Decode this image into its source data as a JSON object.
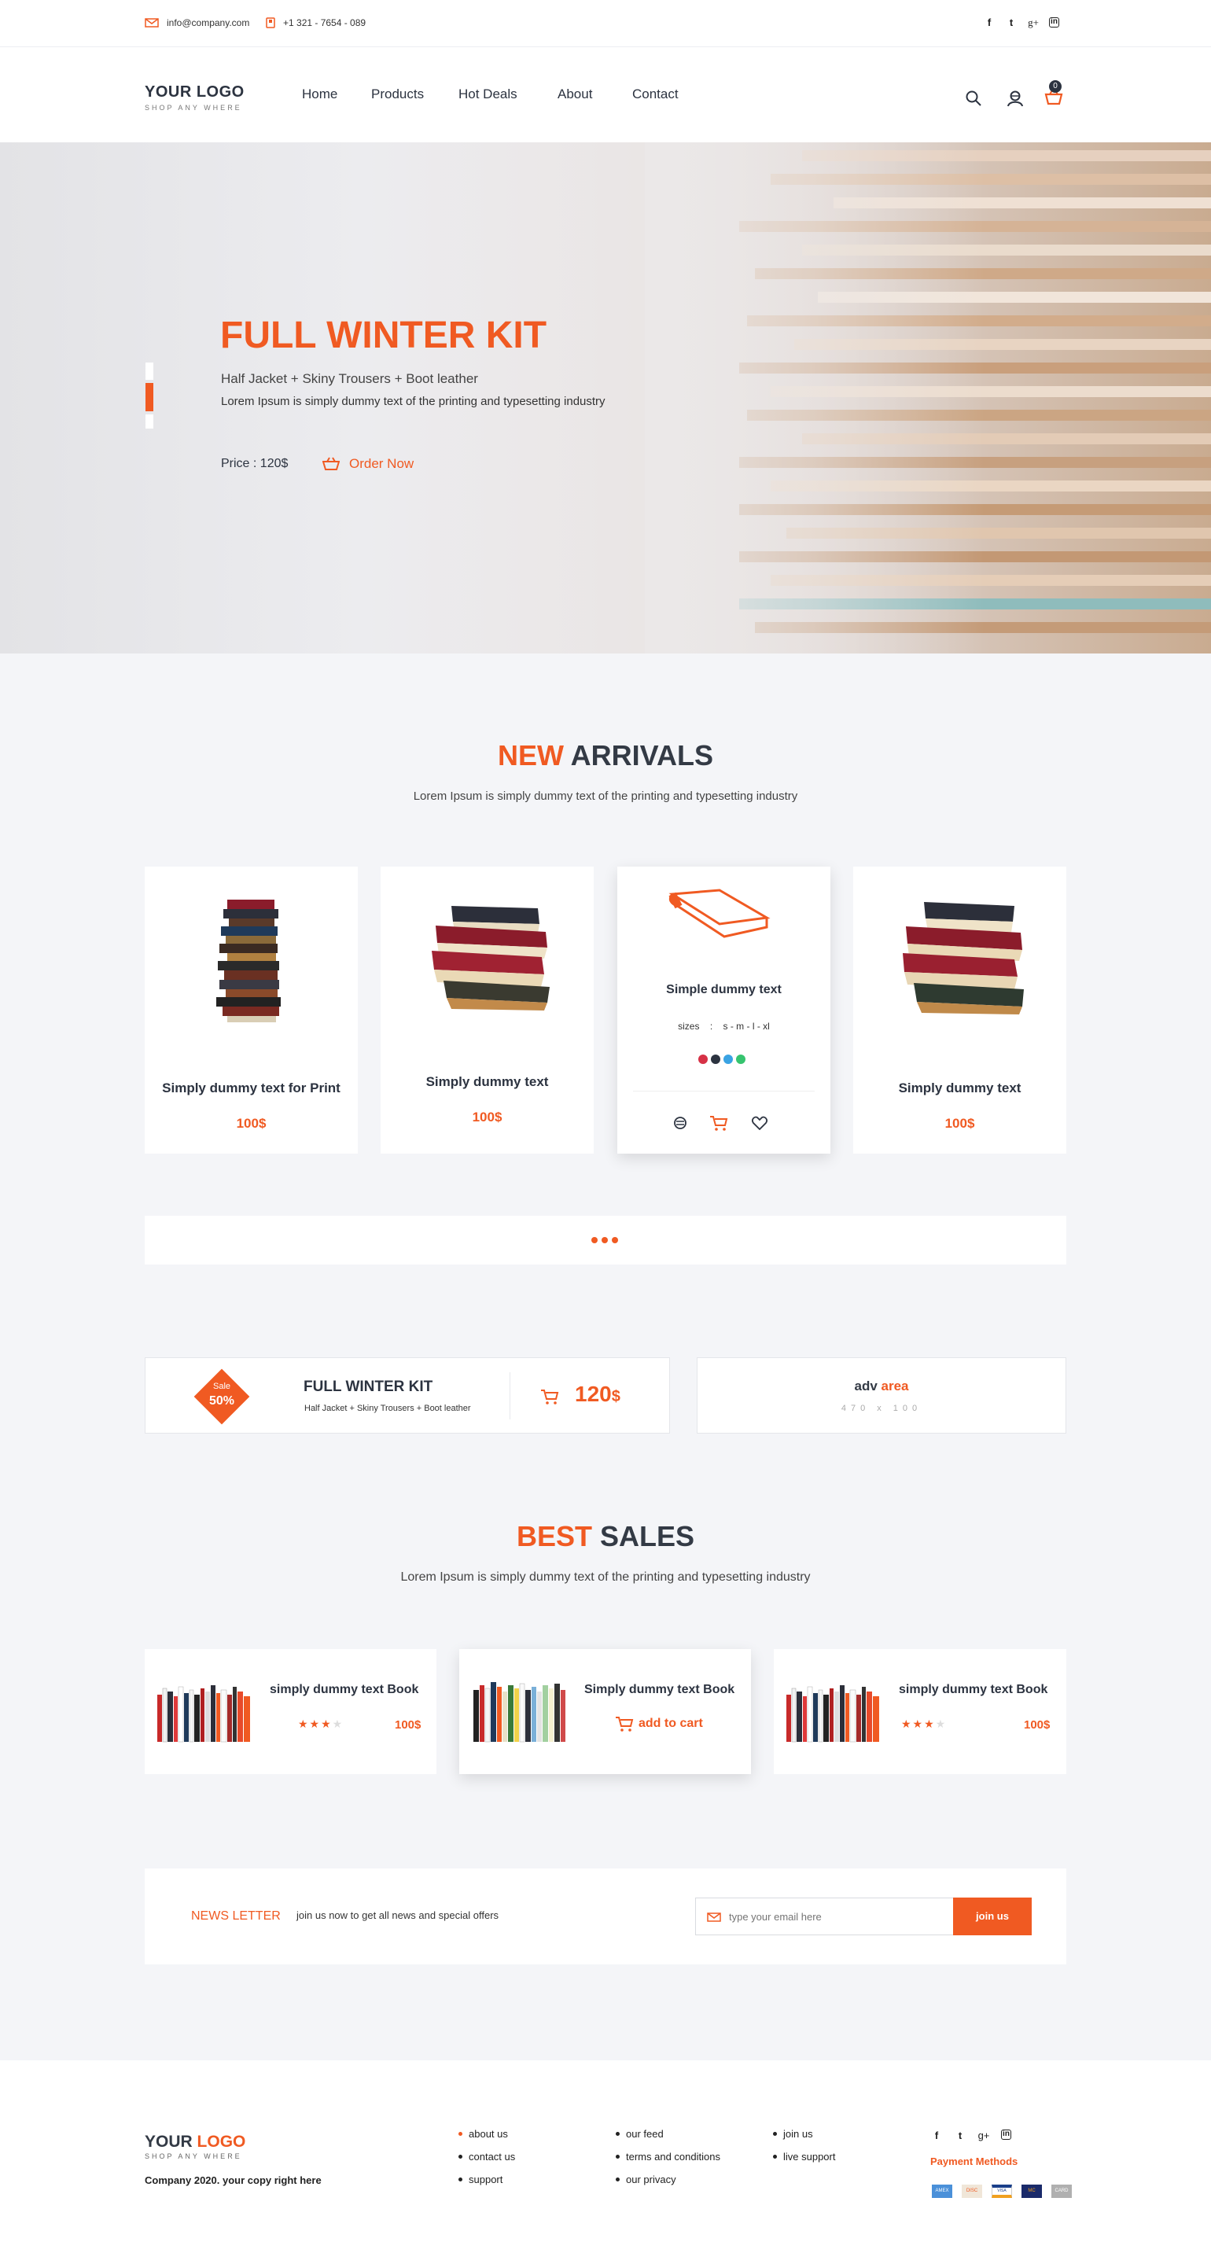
{
  "topbar": {
    "email": "info@company.com",
    "phone": "+1 321 - 7654 - 089",
    "social": [
      "f",
      "t",
      "g+",
      "in"
    ]
  },
  "header": {
    "logo_title": "YOUR LOGO",
    "logo_sub": "SHOP ANY WHERE",
    "nav": [
      "Home",
      "Products",
      "Hot Deals",
      "About",
      "Contact"
    ],
    "cart_count": "0"
  },
  "hero": {
    "title": "FULL WINTER KIT",
    "subtitle": "Half Jacket + Skiny Trousers + Boot leather",
    "desc": "Lorem Ipsum is simply dummy text of the printing and typesetting industry",
    "price": "Price : 120$",
    "cta": "Order Now"
  },
  "new_arrivals": {
    "title_accent": "NEW",
    "title_rest": "ARRIVALS",
    "subtitle": "Lorem Ipsum is simply dummy text of the printing and typesetting industry",
    "products": [
      {
        "title": "Simply dummy text for Print",
        "price": "100$"
      },
      {
        "title": "Simply dummy text",
        "price": "100$"
      },
      {
        "title": "Simple dummy text",
        "sizes_label": "sizes",
        "sizes_sep": ":",
        "sizes": "s - m - l - xl"
      },
      {
        "title": "Simply dummy text",
        "price": "100$"
      }
    ],
    "swatches": [
      "#d63146",
      "#2c3340",
      "#3aa3e3",
      "#36c46f"
    ]
  },
  "promo": {
    "badge_top": "Sale",
    "badge_value": "50%",
    "title": "FULL WINTER KIT",
    "subtitle": "Half Jacket + Skiny Trousers + Boot leather",
    "price": "120",
    "currency": "$",
    "adv_a": "adv",
    "adv_b": "area",
    "adv_size": "470 x 100"
  },
  "best_sales": {
    "title_accent": "BEST",
    "title_rest": "SALES",
    "subtitle": "Lorem Ipsum is simply dummy text of the printing and typesetting industry",
    "items": [
      {
        "title": "simply dummy text Book",
        "price": "100$",
        "rating": 3
      },
      {
        "title": "Simply dummy text Book",
        "cta": "add to cart"
      },
      {
        "title": "simply dummy text Book",
        "price": "100$",
        "rating": 3
      }
    ]
  },
  "newsletter": {
    "label": "NEWS LETTER",
    "text": "join us now to get all news and special offers",
    "placeholder": "type your email here",
    "button": "join us"
  },
  "footer": {
    "logo_a": "YOUR",
    "logo_b": "LOGO",
    "logo_sub": "SHOP ANY WHERE",
    "copyright": "Company 2020. your copy right here",
    "col1": [
      "about us",
      "contact us",
      "support"
    ],
    "col2": [
      "our feed",
      "terms and conditions",
      "our privacy"
    ],
    "col3": [
      "join us",
      "live support"
    ],
    "payment_label": "Payment Methods",
    "payments": [
      "AMEX",
      "DISC",
      "VISA",
      "MC",
      "CARD"
    ]
  },
  "colors": {
    "accent": "#f05a22",
    "dark": "#2c3340",
    "bg": "#f4f5f8"
  }
}
